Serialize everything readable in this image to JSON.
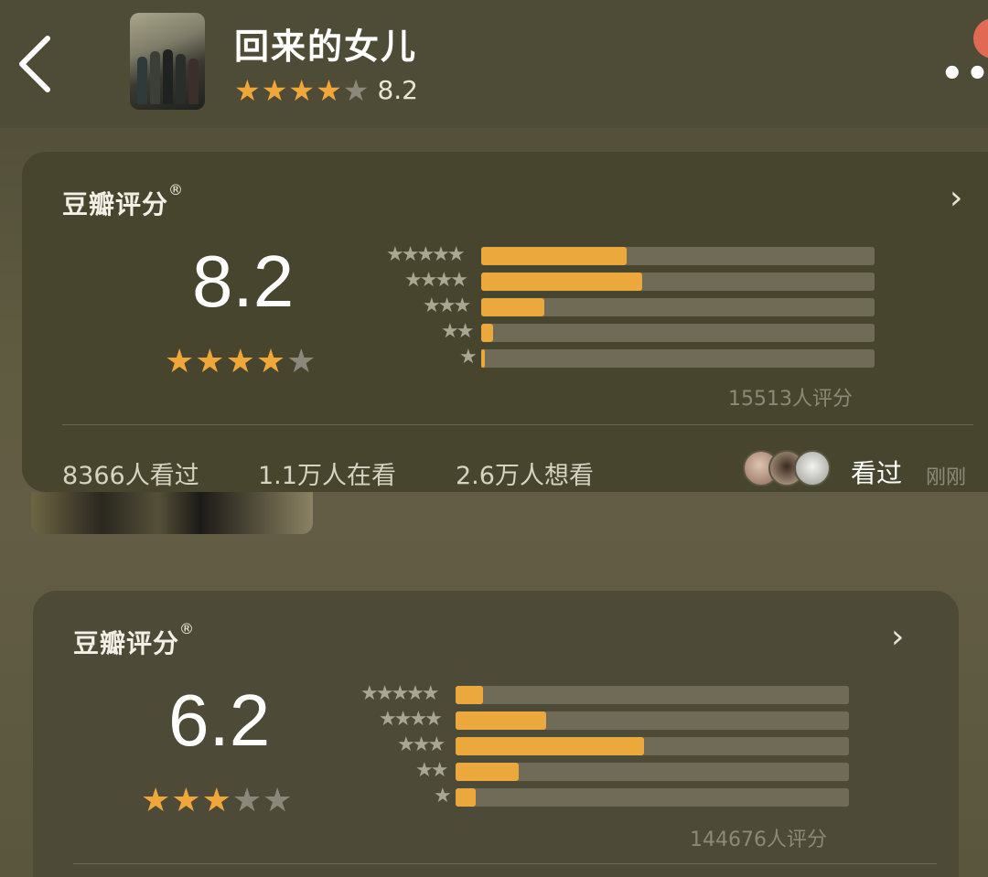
{
  "colors": {
    "star_on": "#f0a73a",
    "star_off": "#8a887a",
    "bar_fill": "#eba83c",
    "bar_track": "#6f6b56"
  },
  "icons": {
    "back": "chevron-left-icon",
    "more": "more-dots-icon",
    "arrow": "chevron-right-icon",
    "star": "star-icon"
  },
  "header": {
    "title": "回来的女儿",
    "rating": 8.2,
    "rating_text": "8.2",
    "stars": 4,
    "more_label": "••"
  },
  "cards": [
    {
      "label": "豆瓣评分",
      "mark": "®",
      "chevron": "›",
      "score": "8.2",
      "stars": 4,
      "distribution": [
        0.37,
        0.41,
        0.16,
        0.03,
        0.01
      ],
      "star_labels": [
        "★★★★★",
        "★★★★",
        "★★★",
        "★★",
        "★"
      ],
      "count": "15513人评分",
      "stats": [
        "8366人看过",
        "1.1万人在看",
        "2.6万人想看"
      ],
      "seen_label": "看过",
      "time_label": "刚刚"
    },
    {
      "label": "豆瓣评分",
      "mark": "®",
      "chevron": "›",
      "score": "6.2",
      "stars": 3,
      "distribution": [
        0.07,
        0.23,
        0.48,
        0.16,
        0.05
      ],
      "star_labels": [
        "★★★★★",
        "★★★★",
        "★★★",
        "★★",
        "★"
      ],
      "count": "144676人评分"
    }
  ]
}
